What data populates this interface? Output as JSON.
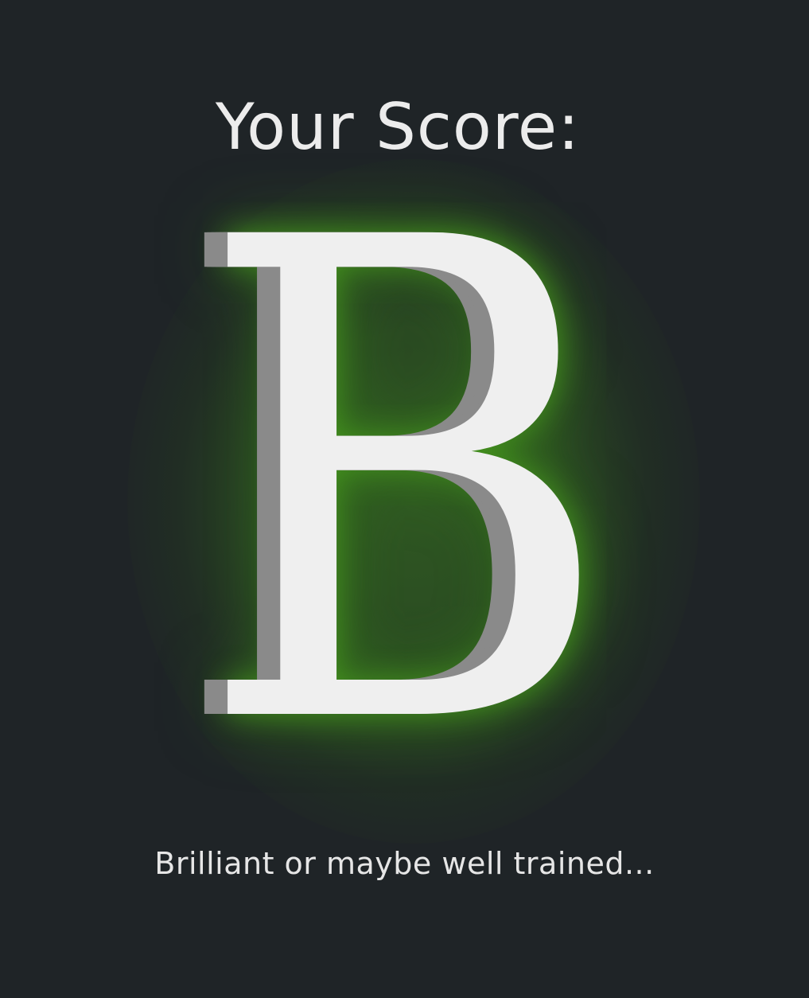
{
  "score_screen": {
    "title": "Your Score:",
    "grade": "B",
    "message": "Brilliant or maybe well trained...",
    "colors": {
      "background": "#1f2427",
      "glow": "#3c821e",
      "letter_face": "#efefef",
      "letter_depth": "#8a8a8a",
      "text": "#ececec"
    }
  }
}
